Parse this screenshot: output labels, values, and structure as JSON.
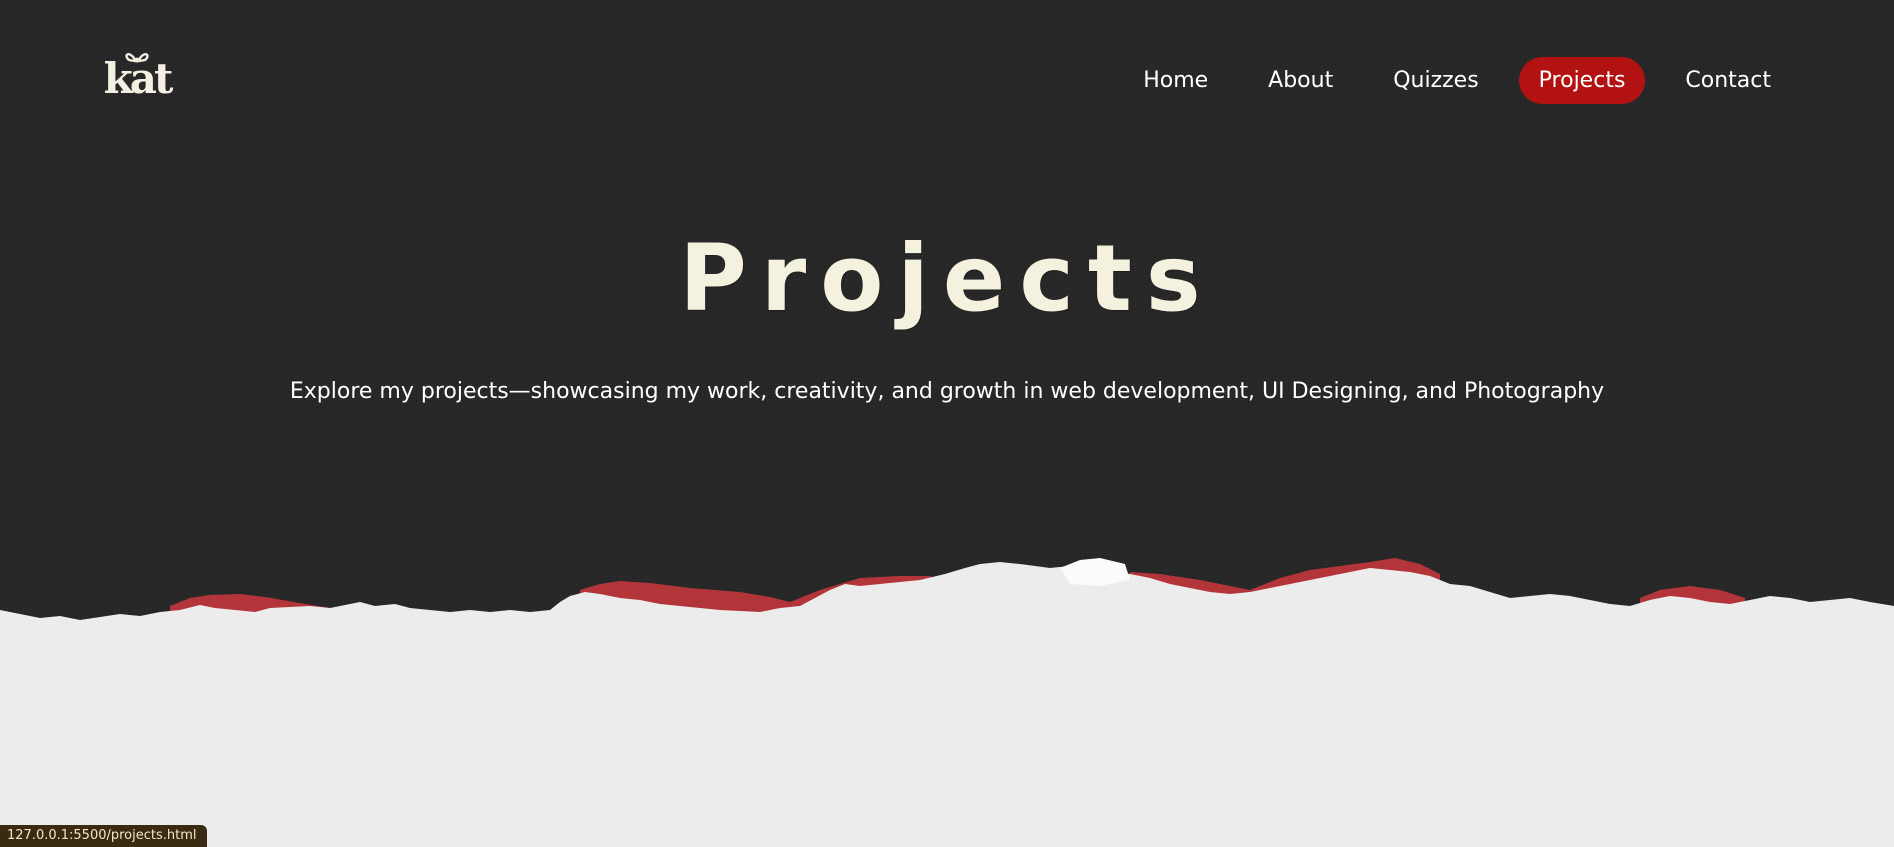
{
  "header": {
    "logo_text": "kat",
    "nav": [
      {
        "label": "Home",
        "active": false
      },
      {
        "label": "About",
        "active": false
      },
      {
        "label": "Quizzes",
        "active": false
      },
      {
        "label": "Projects",
        "active": true
      },
      {
        "label": "Contact",
        "active": false
      }
    ]
  },
  "hero": {
    "title": "Projects",
    "subtitle": "Explore my projects—showcasing my work, creativity, and growth in web development, UI Designing, and Photography"
  },
  "status_bar": {
    "url": "127.0.0.1:5500/projects.html"
  },
  "colors": {
    "background": "#272727",
    "accent": "#b31212",
    "title": "#f5f1df",
    "paper": "#efefef",
    "torn_red": "#b3353a"
  }
}
